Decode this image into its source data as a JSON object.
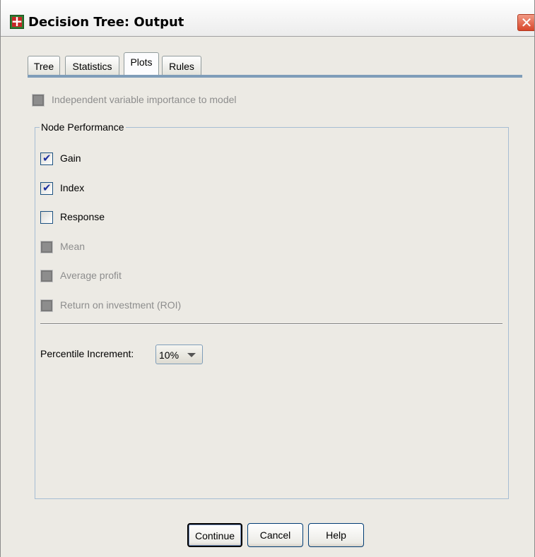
{
  "window": {
    "title": "Decision Tree: Output",
    "app_icon": "spss-tree-icon",
    "close_icon": "close-icon",
    "close_symbol": "✕"
  },
  "tabs": [
    {
      "label": "Tree",
      "active": false
    },
    {
      "label": "Statistics",
      "active": false
    },
    {
      "label": "Plots",
      "active": true
    },
    {
      "label": "Rules",
      "active": false
    }
  ],
  "independent_importance": {
    "label": "Independent variable importance to model",
    "checked": false,
    "enabled": false
  },
  "node_performance": {
    "legend": "Node Performance",
    "items": [
      {
        "label": "Gain",
        "checked": true,
        "enabled": true
      },
      {
        "label": "Index",
        "checked": true,
        "enabled": true
      },
      {
        "label": "Response",
        "checked": false,
        "enabled": true
      },
      {
        "label": "Mean",
        "checked": false,
        "enabled": false
      },
      {
        "label": "Average profit",
        "checked": false,
        "enabled": false
      },
      {
        "label": "Return on investment (ROI)",
        "checked": false,
        "enabled": false
      }
    ]
  },
  "percentile": {
    "label": "Percentile Increment:",
    "value": "10%"
  },
  "buttons": {
    "continue": "Continue",
    "cancel": "Cancel",
    "help": "Help"
  }
}
